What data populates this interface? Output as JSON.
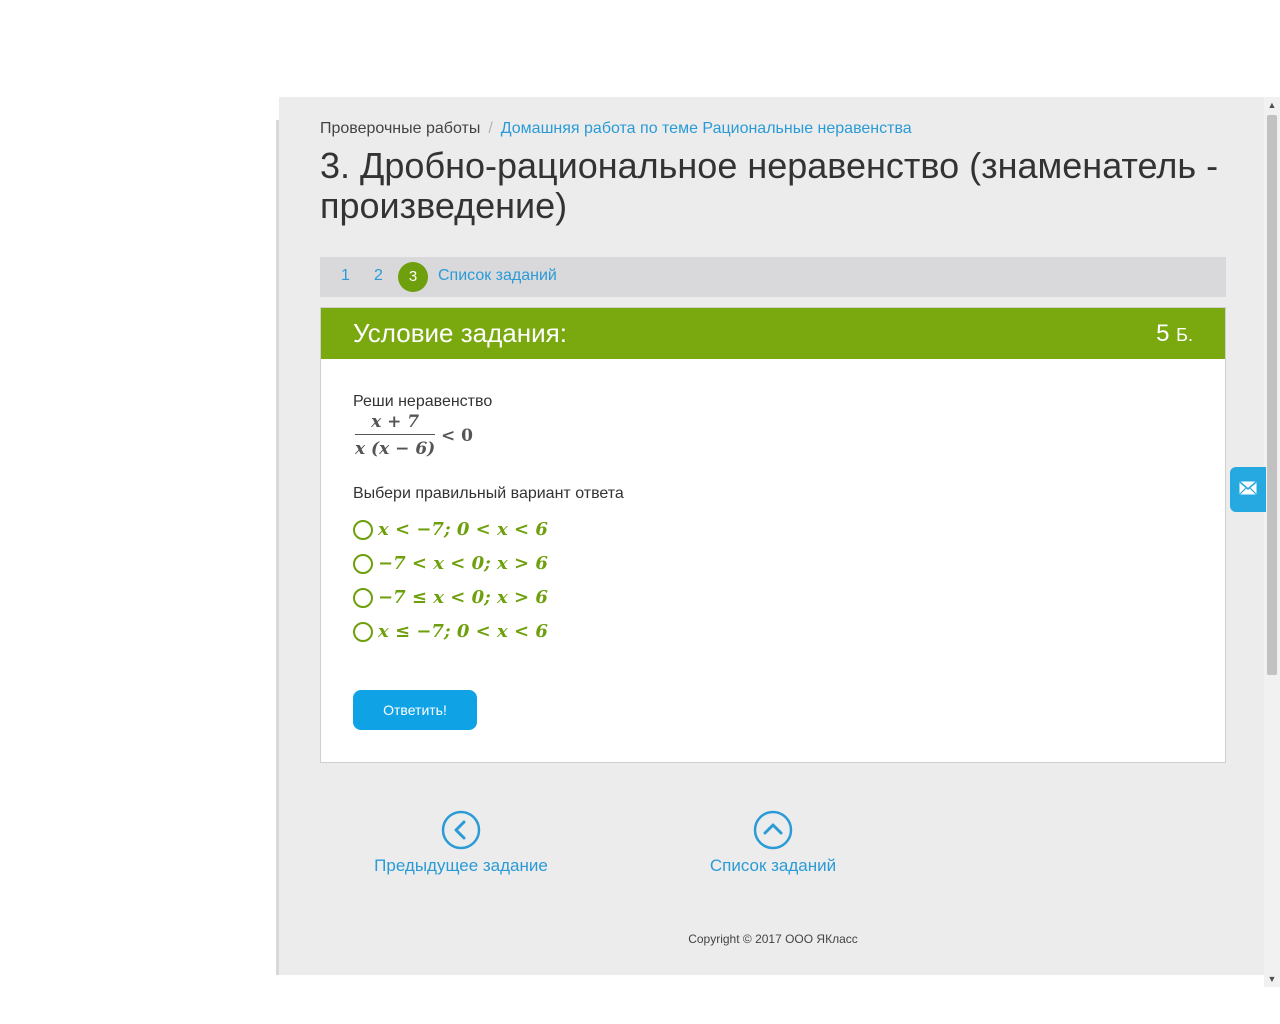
{
  "breadcrumb": {
    "root": "Проверочные работы",
    "separator": "/",
    "current": "Домашняя работа по теме Рациональные неравенства"
  },
  "page": {
    "title": "3. Дробно-рациональное неравенство (знаменатель - произведение)"
  },
  "task_nav": {
    "items": [
      "1",
      "2"
    ],
    "current": "3",
    "list_label": "Список заданий"
  },
  "task": {
    "header": "Условие задания:",
    "points": "5",
    "points_unit": "Б.",
    "question": "Реши неравенство",
    "expression": {
      "numerator": "x + 7",
      "denominator": "x (x − 6)",
      "relation": "< 0"
    },
    "prompt": "Выбери правильный вариант ответа",
    "options": [
      "x < −7; 0 < x < 6",
      "−7 < x < 0; x > 6",
      "−7 ≤ x < 0; x > 6",
      "x ≤ −7; 0 < x < 6"
    ],
    "submit_label": "Ответить!"
  },
  "footer_nav": {
    "prev_label": "Предыдущее задание",
    "list_label": "Список заданий"
  },
  "copyright": "Copyright © 2017 ООО ЯКласс",
  "colors": {
    "accent_green": "#79a80f",
    "link_blue": "#2a9bd6",
    "button_blue": "#0fa3e6"
  },
  "icons": {
    "mail": "envelope-icon",
    "prev": "chevron-left-circle-icon",
    "list": "chevron-up-circle-icon"
  }
}
